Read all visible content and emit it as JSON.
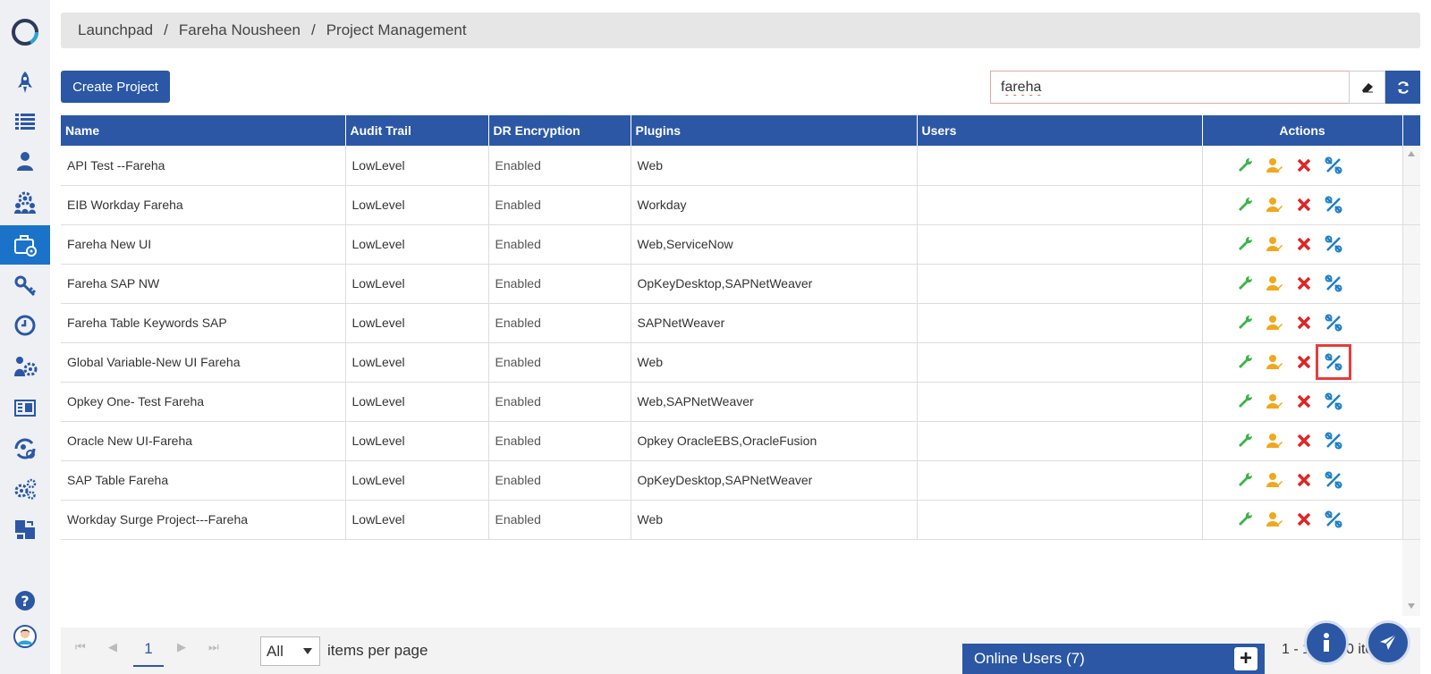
{
  "breadcrumb": [
    "Launchpad",
    "Fareha Nousheen",
    "Project Management"
  ],
  "toolbar": {
    "create_label": "Create Project",
    "search_value": "fareha"
  },
  "table": {
    "headers": [
      "Name",
      "Audit Trail",
      "DR Encryption",
      "Plugins",
      "Users",
      "Actions"
    ],
    "rows": [
      {
        "name": "API Test --Fareha",
        "audit": "LowLevel",
        "encryption": "Enabled",
        "plugins": "Web",
        "users": ""
      },
      {
        "name": "EIB Workday Fareha",
        "audit": "LowLevel",
        "encryption": "Enabled",
        "plugins": "Workday",
        "users": ""
      },
      {
        "name": "Fareha New UI",
        "audit": "LowLevel",
        "encryption": "Enabled",
        "plugins": "Web,ServiceNow",
        "users": ""
      },
      {
        "name": "Fareha SAP NW",
        "audit": "LowLevel",
        "encryption": "Enabled",
        "plugins": "OpKeyDesktop,SAPNetWeaver",
        "users": ""
      },
      {
        "name": "Fareha Table Keywords SAP",
        "audit": "LowLevel",
        "encryption": "Enabled",
        "plugins": "SAPNetWeaver",
        "users": ""
      },
      {
        "name": "Global Variable-New UI Fareha",
        "audit": "LowLevel",
        "encryption": "Enabled",
        "plugins": "Web",
        "users": ""
      },
      {
        "name": "Opkey One- Test Fareha",
        "audit": "LowLevel",
        "encryption": "Enabled",
        "plugins": "Web,SAPNetWeaver",
        "users": ""
      },
      {
        "name": "Oracle New UI-Fareha",
        "audit": "LowLevel",
        "encryption": "Enabled",
        "plugins": "Opkey OracleEBS,OracleFusion",
        "users": ""
      },
      {
        "name": "SAP Table Fareha",
        "audit": "LowLevel",
        "encryption": "Enabled",
        "plugins": "OpKeyDesktop,SAPNetWeaver",
        "users": ""
      },
      {
        "name": "Workday Surge Project---Fareha",
        "audit": "LowLevel",
        "encryption": "Enabled",
        "plugins": "Web",
        "users": ""
      }
    ],
    "highlighted_row": 5
  },
  "pager": {
    "current_page": "1",
    "items_per_page": "All",
    "items_label": "items per page",
    "range_text": "1 - 10 of 10 items"
  },
  "online_users": {
    "label": "Online Users (7)",
    "plus": "+"
  },
  "colors": {
    "primary": "#2b57a5",
    "active_sidebar": "#1a73c8",
    "wrench": "#3cb34a",
    "user_edit": "#f0a81c",
    "delete": "#e02424",
    "tools": "#1f7fc4",
    "highlight": "#e53e3e"
  },
  "icons": {
    "sidebar": [
      "rocket-icon",
      "list-icon",
      "user-icon",
      "team-settings-icon",
      "briefcase-settings-icon",
      "key-icon",
      "clock-icon",
      "user-gear-icon",
      "report-icon",
      "user-sync-icon",
      "gears-icon",
      "export-icon",
      "help-icon",
      "avatar-icon"
    ],
    "row_actions": [
      "wrench-icon",
      "user-edit-icon",
      "delete-icon",
      "tools-icon"
    ]
  }
}
